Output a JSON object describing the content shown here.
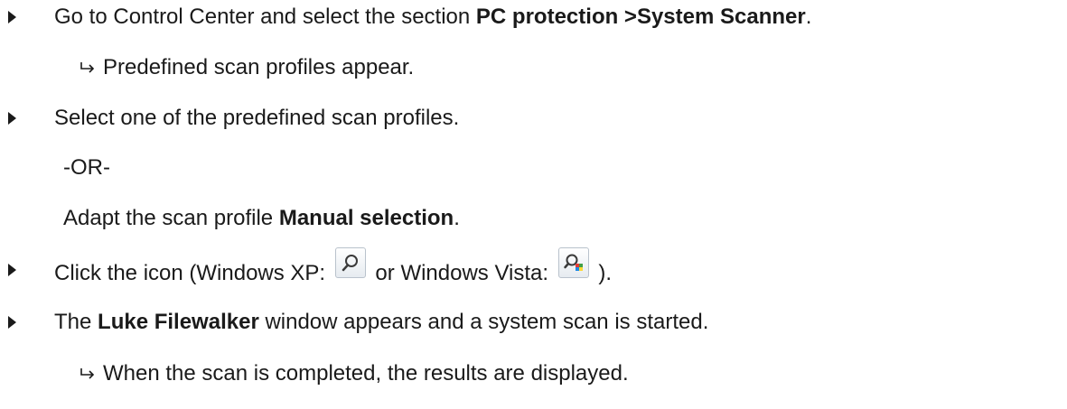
{
  "steps": [
    {
      "type": "action",
      "prefix": "Go to Control Center and select the section ",
      "bold": "PC protection >System Scanner",
      "suffix": "."
    },
    {
      "type": "result",
      "text": "Predefined scan profiles appear."
    },
    {
      "type": "action",
      "text": "Select one of the predefined scan profiles."
    },
    {
      "type": "plain",
      "text": "-OR-"
    },
    {
      "type": "plain",
      "prefix": "Adapt the scan profile ",
      "bold": "Manual selection",
      "suffix": "."
    },
    {
      "type": "action",
      "prefix": "Click the icon (Windows XP: ",
      "middle": " or Windows Vista: ",
      "suffix": " ).",
      "icons": [
        "search-magnifier-icon",
        "search-magnifier-vista-icon"
      ]
    },
    {
      "type": "action",
      "prefix": "The ",
      "bold": "Luke Filewalker",
      "suffix": " window appears and a system scan is started."
    },
    {
      "type": "result",
      "text": "When the scan is completed, the results are displayed."
    }
  ]
}
